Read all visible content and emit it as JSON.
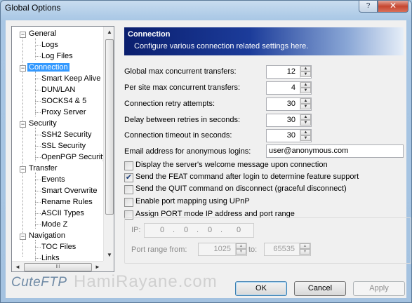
{
  "window": {
    "title": "Global Options",
    "help_glyph": "?",
    "close_glyph": "✕"
  },
  "tree": {
    "items": [
      {
        "label": "General",
        "expander": "−"
      },
      {
        "label": "Logs"
      },
      {
        "label": "Log Files"
      },
      {
        "label": "Connection",
        "expander": "−",
        "selected": true
      },
      {
        "label": "Smart Keep Alive"
      },
      {
        "label": "DUN/LAN"
      },
      {
        "label": "SOCKS4 & 5"
      },
      {
        "label": "Proxy Server"
      },
      {
        "label": "Security",
        "expander": "−"
      },
      {
        "label": "SSH2 Security"
      },
      {
        "label": "SSL Security"
      },
      {
        "label": "OpenPGP Security"
      },
      {
        "label": "Transfer",
        "expander": "−"
      },
      {
        "label": "Events"
      },
      {
        "label": "Smart Overwrite"
      },
      {
        "label": "Rename Rules"
      },
      {
        "label": "ASCII Types"
      },
      {
        "label": "Mode Z"
      },
      {
        "label": "Navigation",
        "expander": "−"
      },
      {
        "label": "TOC Files"
      },
      {
        "label": "Links"
      }
    ],
    "scroll_up": "▲",
    "scroll_down": "▼",
    "scroll_left": "◄",
    "scroll_right": "►",
    "hthumb_grip": "III"
  },
  "banner": {
    "title": "Connection",
    "subtitle": "Configure various connection related settings here."
  },
  "fields": {
    "max_transfers": {
      "label": "Global max concurrent transfers:",
      "value": "12"
    },
    "per_site": {
      "label": "Per site max concurrent transfers:",
      "value": "4"
    },
    "retry": {
      "label": "Connection retry attempts:",
      "value": "30"
    },
    "delay": {
      "label": "Delay between retries in seconds:",
      "value": "30"
    },
    "timeout": {
      "label": "Connection timeout in seconds:",
      "value": "30"
    },
    "email": {
      "label": "Email address for anonymous logins:",
      "value": "user@anonymous.com"
    }
  },
  "spin": {
    "up": "▲",
    "down": "▼"
  },
  "checks": {
    "welcome": {
      "label": "Display the server's welcome message upon connection",
      "checked": false
    },
    "feat": {
      "label": "Send the FEAT command after login to determine feature support",
      "checked": true,
      "mark": "✔"
    },
    "quit": {
      "label": "Send the QUIT command on disconnect (graceful disconnect)",
      "checked": false
    },
    "upnp": {
      "label": "Enable port mapping using UPnP",
      "checked": false
    },
    "port": {
      "label": "Assign PORT mode IP address and port range",
      "checked": false
    }
  },
  "port_group": {
    "ip_label": "IP:",
    "ip_octets": [
      "0",
      "0",
      "0",
      "0"
    ],
    "ip_dot": ".",
    "range_from_label": "Port range from:",
    "range_from": "1025",
    "range_to_label": "to:",
    "range_to": "65535"
  },
  "footer": {
    "brand": "CuteFTP",
    "watermark": "HamiRayane.com"
  },
  "buttons": {
    "ok": "OK",
    "cancel": "Cancel",
    "apply": "Apply"
  }
}
